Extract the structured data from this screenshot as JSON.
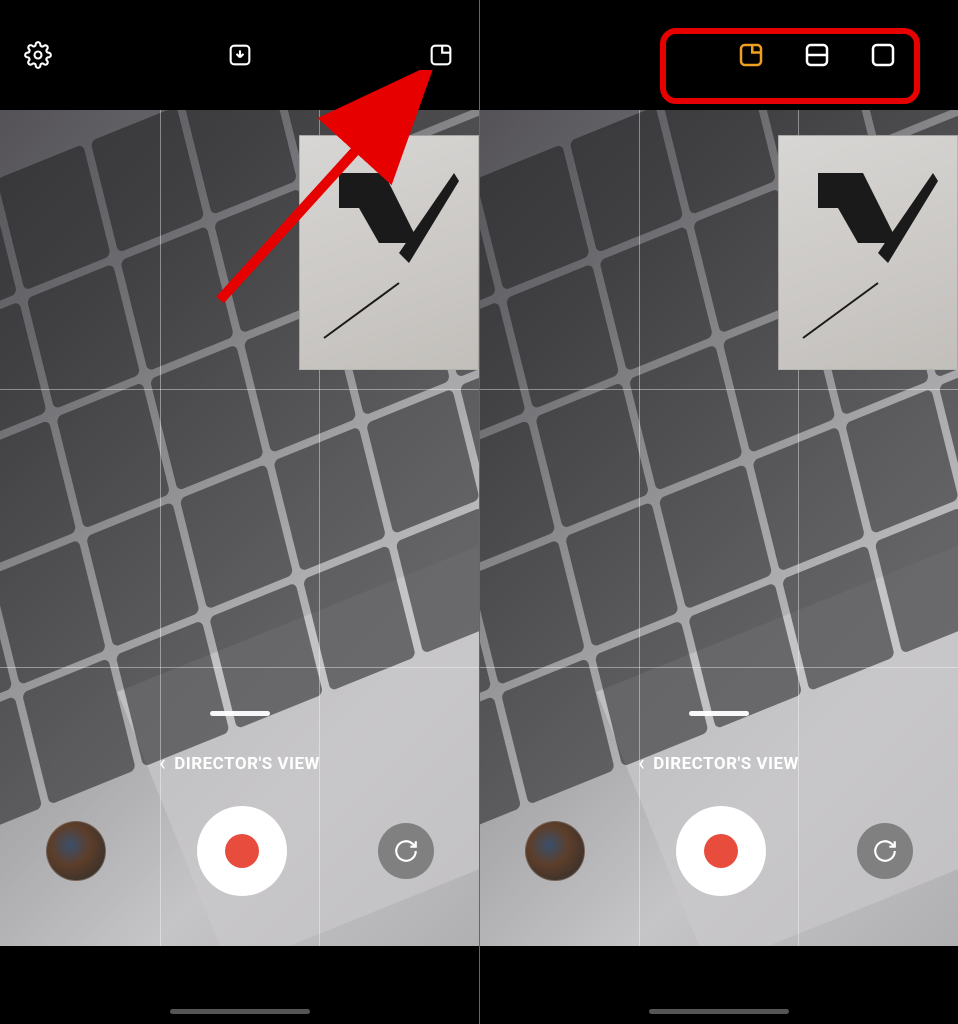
{
  "mode_label": "DIRECTOR'S VIEW",
  "icons": {
    "settings": "settings",
    "download": "download",
    "layout": "layout-pip",
    "layout_pip": "pip",
    "layout_split": "split",
    "layout_single": "single",
    "chevron": "‹",
    "switch": "switch-camera"
  },
  "annotation": {
    "arrow_target": "layout-button",
    "highlight": "layout-options"
  }
}
